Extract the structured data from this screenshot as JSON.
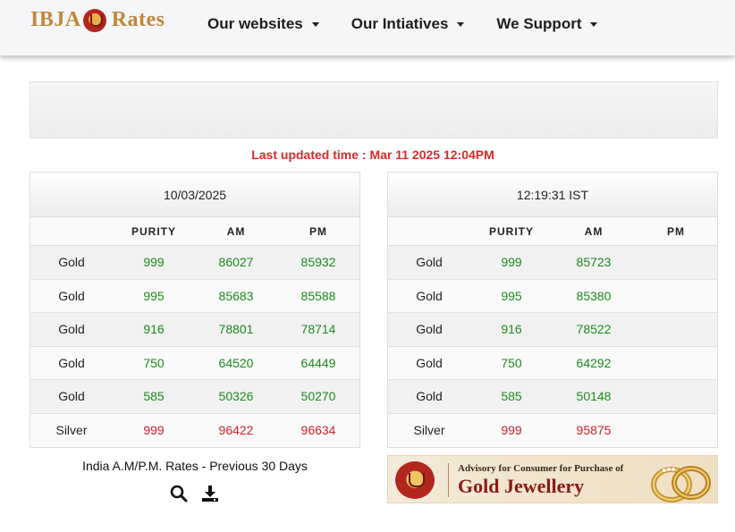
{
  "brand": {
    "left": "IBJA",
    "right": "Rates"
  },
  "nav": [
    {
      "label": "Our websites"
    },
    {
      "label": "Our Intiatives"
    },
    {
      "label": "We Support"
    }
  ],
  "last_updated": "Last updated time : Mar 11 2025 12:04PM",
  "left_table": {
    "caption": "10/03/2025",
    "headers": [
      "",
      "PURITY",
      "AM",
      "PM"
    ],
    "rows": [
      {
        "metal": "Gold",
        "purity": "999",
        "am": "86027",
        "pm": "85932"
      },
      {
        "metal": "Gold",
        "purity": "995",
        "am": "85683",
        "pm": "85588"
      },
      {
        "metal": "Gold",
        "purity": "916",
        "am": "78801",
        "pm": "78714"
      },
      {
        "metal": "Gold",
        "purity": "750",
        "am": "64520",
        "pm": "64449"
      },
      {
        "metal": "Gold",
        "purity": "585",
        "am": "50326",
        "pm": "50270"
      },
      {
        "metal": "Silver",
        "purity": "999",
        "am": "96422",
        "pm": "96634"
      }
    ]
  },
  "right_table": {
    "caption": "12:19:31 IST",
    "headers": [
      "",
      "PURITY",
      "AM",
      "PM"
    ],
    "rows": [
      {
        "metal": "Gold",
        "purity": "999",
        "am": "85723",
        "pm": ""
      },
      {
        "metal": "Gold",
        "purity": "995",
        "am": "85380",
        "pm": ""
      },
      {
        "metal": "Gold",
        "purity": "916",
        "am": "78522",
        "pm": ""
      },
      {
        "metal": "Gold",
        "purity": "750",
        "am": "64292",
        "pm": ""
      },
      {
        "metal": "Gold",
        "purity": "585",
        "am": "50148",
        "pm": ""
      },
      {
        "metal": "Silver",
        "purity": "999",
        "am": "95875",
        "pm": ""
      }
    ]
  },
  "previous_30_days": "India A.M/P.M. Rates - Previous 30 Days",
  "advisory": {
    "line1": "Advisory for Consumer for Purchase of",
    "line2": "Gold Jewellery"
  },
  "colors": {
    "gold_value": "#1e8a1e",
    "silver_value": "#d0222a",
    "updated_text": "#d92a2a",
    "brand": "#c0873a"
  },
  "icons": [
    "search-icon",
    "download-icon",
    "caret-down-icon"
  ]
}
